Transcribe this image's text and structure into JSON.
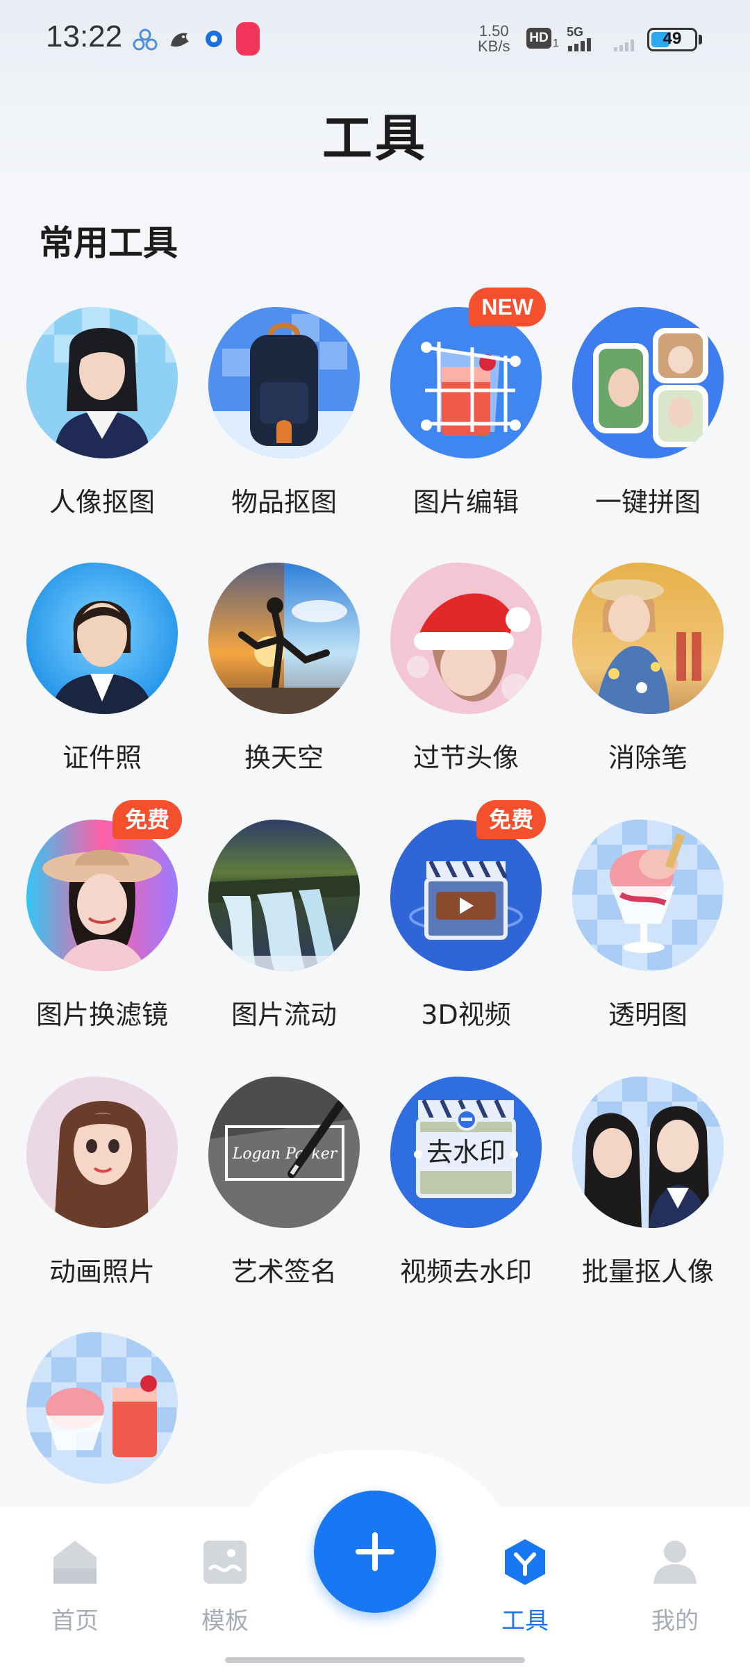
{
  "status_bar": {
    "time": "13:22",
    "net_speed_value": "1.50",
    "net_speed_unit": "KB/s",
    "hd": "HD",
    "sim": "1",
    "network": "5G",
    "battery": "49",
    "battery_level": 0.49,
    "notification_icons": [
      "multi-dot-app-icon",
      "bird-icon",
      "circle-dot-icon",
      "red-pill-app-icon"
    ]
  },
  "page": {
    "title": "工具"
  },
  "section": {
    "title": "常用工具"
  },
  "tools": [
    {
      "label": "人像抠图",
      "icon": "portrait-cutout-icon"
    },
    {
      "label": "物品抠图",
      "icon": "object-cutout-icon"
    },
    {
      "label": "图片编辑",
      "icon": "image-edit-icon",
      "badge": "NEW"
    },
    {
      "label": "一键拼图",
      "icon": "collage-icon"
    },
    {
      "label": "证件照",
      "icon": "id-photo-icon"
    },
    {
      "label": "换天空",
      "icon": "sky-replace-icon"
    },
    {
      "label": "过节头像",
      "icon": "holiday-avatar-icon"
    },
    {
      "label": "消除笔",
      "icon": "eraser-pen-icon"
    },
    {
      "label": "图片换滤镜",
      "icon": "filter-icon",
      "badge": "免费"
    },
    {
      "label": "图片流动",
      "icon": "image-flow-icon"
    },
    {
      "label": "3D视频",
      "icon": "3d-video-icon",
      "badge": "免费"
    },
    {
      "label": "透明图",
      "icon": "transparent-image-icon"
    },
    {
      "label": "动画照片",
      "icon": "animated-photo-icon"
    },
    {
      "label": "艺术签名",
      "icon": "art-signature-icon",
      "signature_text": "Logan Parker"
    },
    {
      "label": "视频去水印",
      "icon": "video-watermark-remove-icon",
      "overlay_text": "去水印"
    },
    {
      "label": "批量抠人像",
      "icon": "batch-portrait-cutout-icon"
    },
    {
      "label": "",
      "icon": "transparent-dessert-icon"
    }
  ],
  "bottom_nav": {
    "items": [
      {
        "label": "首页",
        "icon": "home-icon"
      },
      {
        "label": "模板",
        "icon": "template-icon"
      },
      {
        "label": "工具",
        "icon": "tools-icon",
        "active": true
      },
      {
        "label": "我的",
        "icon": "profile-icon"
      }
    ],
    "fab_icon": "plus-icon",
    "active_color": "#1877f2",
    "inactive_color": "#a6acb6"
  }
}
